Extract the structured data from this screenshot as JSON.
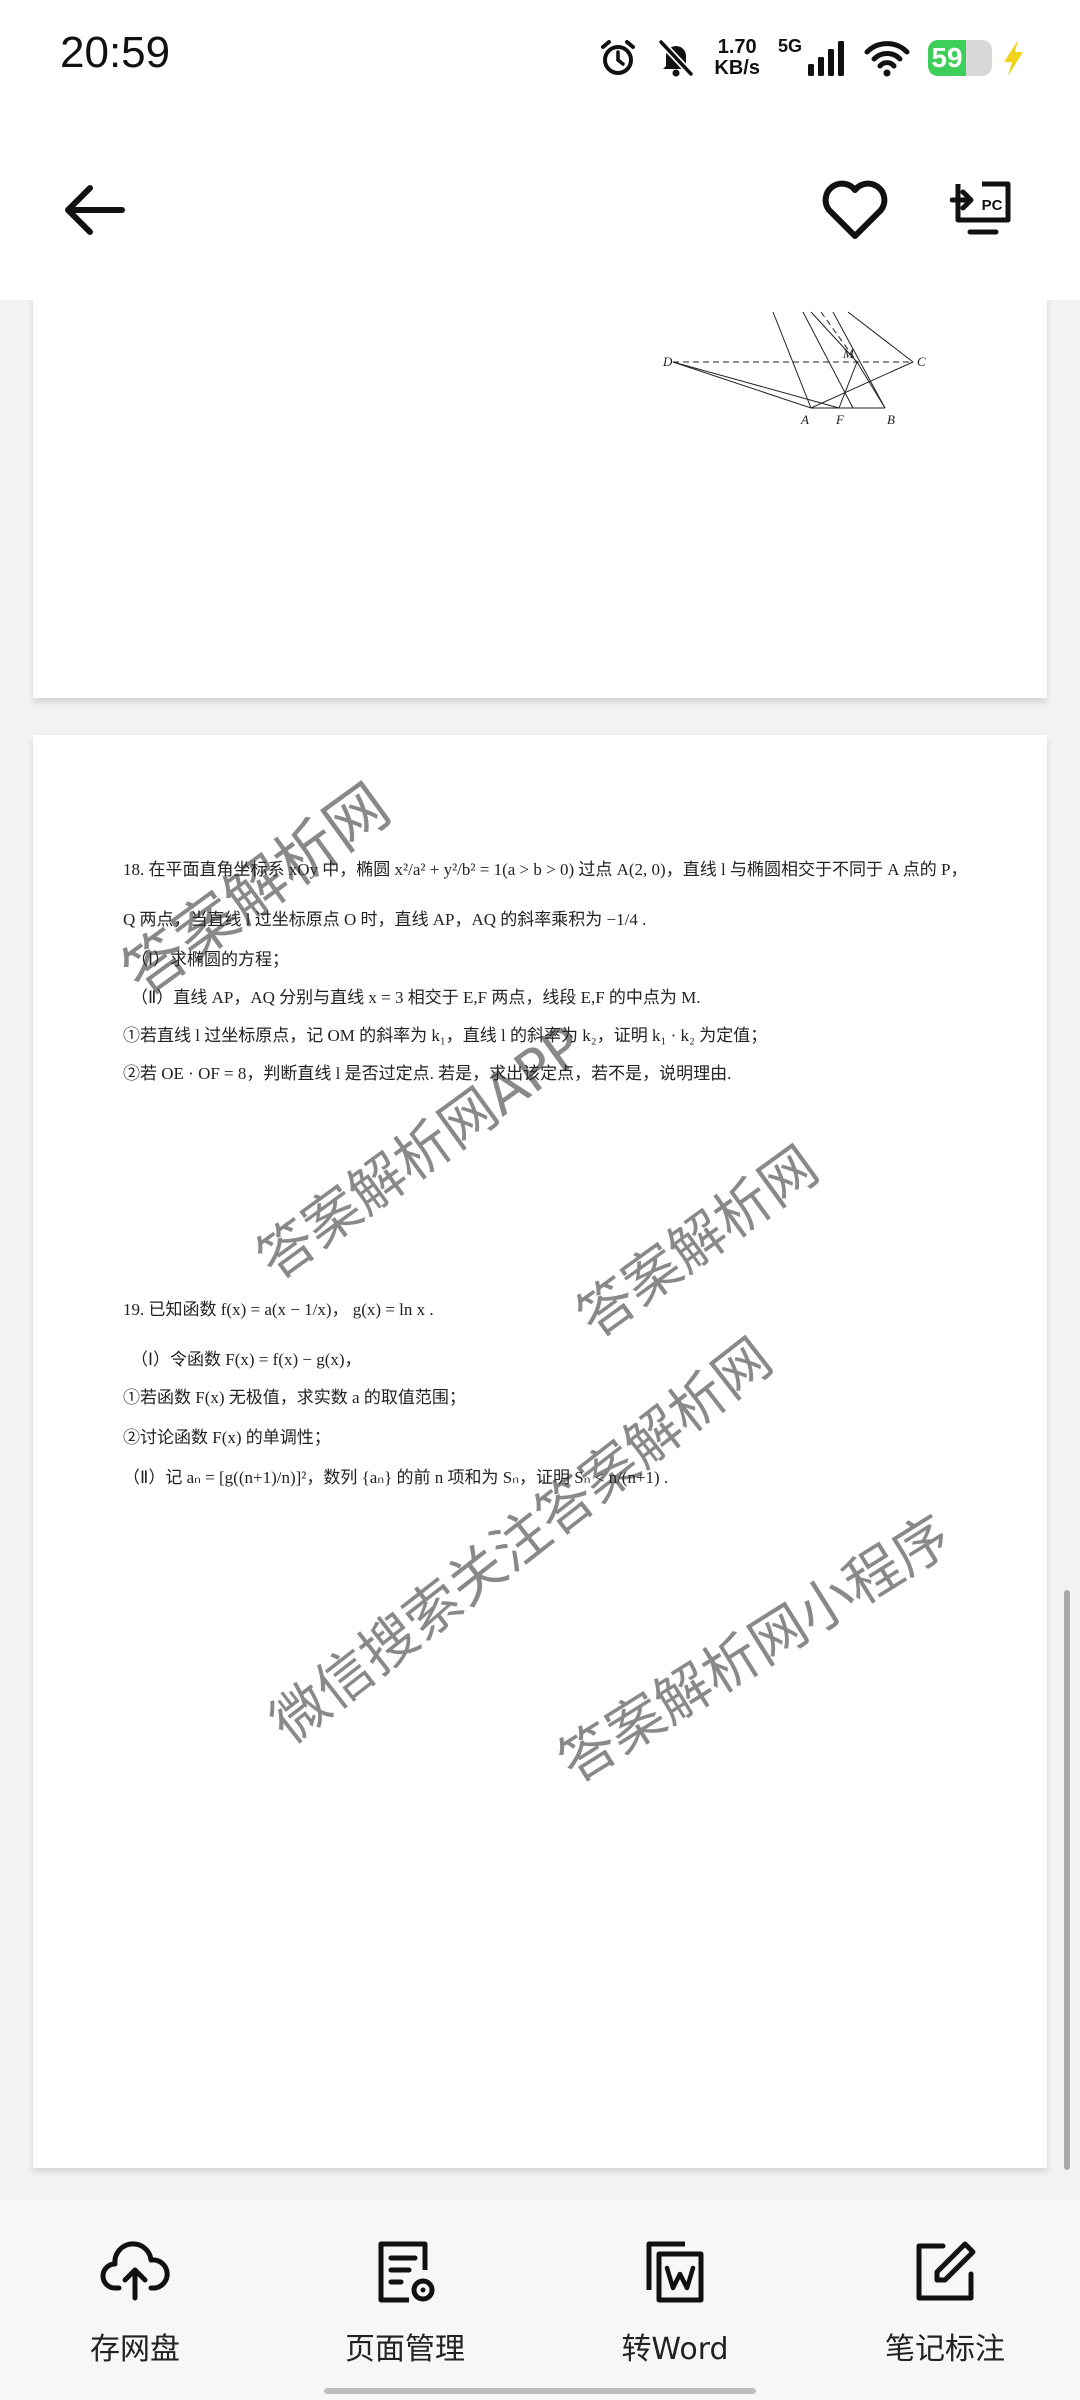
{
  "status_bar": {
    "time": "20:59",
    "speed_value": "1.70",
    "speed_unit": "KB/s",
    "network": "5G",
    "battery_level": "59",
    "battery_fraction": 0.59,
    "icons": [
      "alarm-icon",
      "mute-bell-icon",
      "signal-icon",
      "wifi-icon",
      "battery-icon",
      "charging-icon"
    ]
  },
  "toolbar": {
    "back_icon": "arrow-left-icon",
    "favorite_icon": "heart-icon",
    "pc_icon": "pc-transfer-icon",
    "pc_label": "PC"
  },
  "figure": {
    "labels": [
      "D",
      "A",
      "F",
      "B",
      "C",
      "M"
    ]
  },
  "problem18": {
    "lines": [
      "18. 在平面直角坐标系 xOy 中，椭圆 x²/a² + y²/b² = 1(a > b > 0) 过点 A(2, 0)，直线 l 与椭圆相交于不同于 A 点的 P，",
      "Q 两点，当直线 l 过坐标原点 O 时，直线 AP，AQ 的斜率乘积为 −1/4 .",
      "（Ⅰ）求椭圆的方程；",
      "（Ⅱ）直线 AP，AQ 分别与直线 x = 3 相交于 E,F 两点，线段 E,F 的中点为 M.",
      "①若直线 l 过坐标原点，记 OM 的斜率为 k₁，直线 l 的斜率为 k₂，证明 k₁ · k₂ 为定值；",
      "②若 OE · OF = 8，判断直线 l 是否过定点. 若是，求出该定点，若不是，说明理由."
    ]
  },
  "problem19": {
    "lines": [
      "19.  已知函数 f(x) = a(x − 1/x)，  g(x) = ln x .",
      "（Ⅰ）令函数 F(x) = f(x) − g(x)，",
      "①若函数 F(x) 无极值，求实数 a 的取值范围；",
      "②讨论函数 F(x) 的单调性；",
      "（Ⅱ）记 aₙ = [g((n+1)/n)]²，数列 {aₙ} 的前 n 项和为 Sₙ，证明 Sₙ < n/(n+1) ."
    ]
  },
  "watermarks": [
    "答案解析网",
    "答案解析网APP",
    "答案解析网",
    "微信搜索关注答案解析网",
    "答案解析网小程序"
  ],
  "bottom_bar": {
    "items": [
      {
        "label": "存网盘",
        "icon": "cloud-upload-icon"
      },
      {
        "label": "页面管理",
        "icon": "page-manage-icon"
      },
      {
        "label": "转Word",
        "icon": "word-convert-icon"
      },
      {
        "label": "笔记标注",
        "icon": "note-edit-icon"
      }
    ]
  }
}
